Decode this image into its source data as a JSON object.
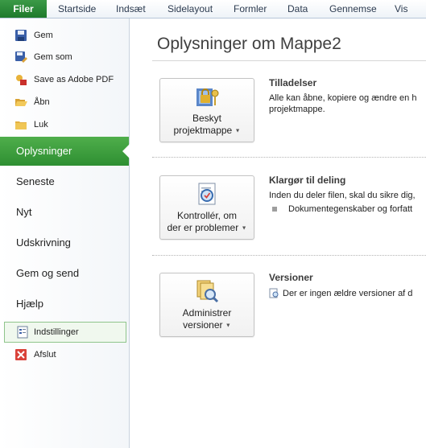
{
  "ribbon": {
    "tabs": [
      {
        "label": "Filer"
      },
      {
        "label": "Startside"
      },
      {
        "label": "Indsæt"
      },
      {
        "label": "Sidelayout"
      },
      {
        "label": "Formler"
      },
      {
        "label": "Data"
      },
      {
        "label": "Gennemse"
      },
      {
        "label": "Vis"
      }
    ]
  },
  "sidebar": {
    "commands": [
      {
        "label": "Gem",
        "icon": "save-icon"
      },
      {
        "label": "Gem som",
        "icon": "save-as-icon"
      },
      {
        "label": "Save as Adobe PDF",
        "icon": "pdf-icon"
      },
      {
        "label": "Åbn",
        "icon": "open-folder-icon"
      },
      {
        "label": "Luk",
        "icon": "close-folder-icon"
      }
    ],
    "sections": [
      {
        "label": "Oplysninger",
        "active": true
      },
      {
        "label": "Seneste"
      },
      {
        "label": "Nyt"
      },
      {
        "label": "Udskrivning"
      },
      {
        "label": "Gem og send"
      },
      {
        "label": "Hjælp"
      }
    ],
    "options": {
      "label": "Indstillinger",
      "icon": "options-icon"
    },
    "exit": {
      "label": "Afslut",
      "icon": "exit-icon"
    }
  },
  "main": {
    "title": "Oplysninger om Mappe2",
    "permissions": {
      "button_line1": "Beskyt",
      "button_line2": "projektmappe",
      "icon": "lock-keys-icon",
      "heading": "Tilladelser",
      "text_line1": "Alle kan åbne, kopiere og ændre en h",
      "text_line2": "projektmappe."
    },
    "prepare": {
      "button_line1": "Kontrollér, om",
      "button_line2": "der er problemer",
      "icon": "inspect-document-icon",
      "heading": "Klargør til deling",
      "text_line1": "Inden du deler filen, skal du sikre dig,",
      "bullet": "Dokumentegenskaber og forfatt"
    },
    "versions": {
      "button_line1": "Administrer",
      "button_line2": "versioner",
      "icon": "manage-versions-icon",
      "heading": "Versioner",
      "text_line1": "Der er ingen ældre versioner af d"
    }
  },
  "colors": {
    "file_tab": "#2a8a36",
    "active_section": "#3ea040",
    "options_border": "#8fc58b"
  }
}
